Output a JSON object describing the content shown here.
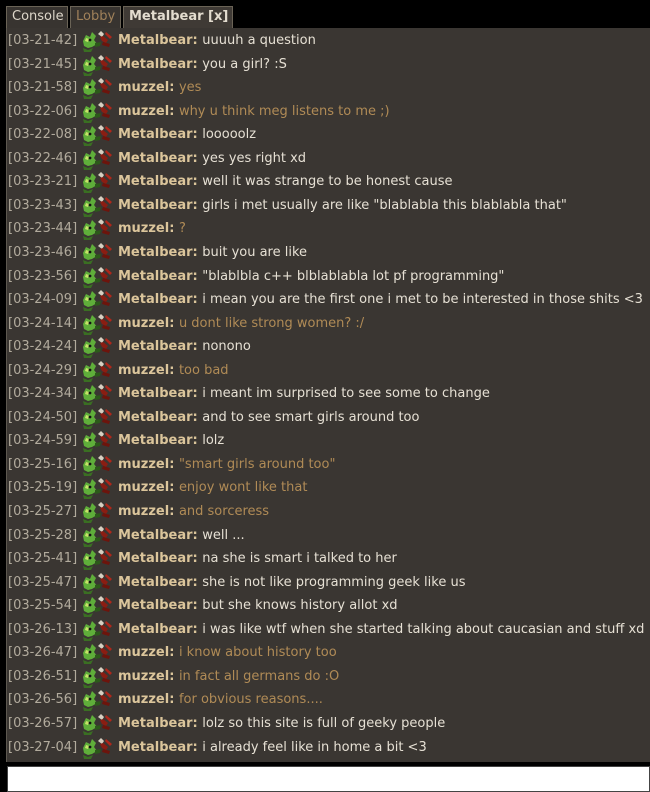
{
  "tabs": [
    {
      "label": "Console"
    },
    {
      "label": "Lobby"
    },
    {
      "label": "Metalbear [x]"
    }
  ],
  "messages": [
    {
      "time": "[03-21-42]",
      "nick": "Metalbear:",
      "text": "uuuuh a question"
    },
    {
      "time": "[03-21-45]",
      "nick": "Metalbear:",
      "text": "you a girl? :S"
    },
    {
      "time": "[03-21-58]",
      "nick": "muzzel:",
      "text": "yes"
    },
    {
      "time": "[03-22-06]",
      "nick": "muzzel:",
      "text": "why u think meg listens to me ;)"
    },
    {
      "time": "[03-22-08]",
      "nick": "Metalbear:",
      "text": "looooolz"
    },
    {
      "time": "[03-22-46]",
      "nick": "Metalbear:",
      "text": "yes yes right xd"
    },
    {
      "time": "[03-23-21]",
      "nick": "Metalbear:",
      "text": "well it was strange to be honest cause"
    },
    {
      "time": "[03-23-43]",
      "nick": "Metalbear:",
      "text": "girls i met usually are like \"blablabla this blablabla that\""
    },
    {
      "time": "[03-23-44]",
      "nick": "muzzel:",
      "text": "?"
    },
    {
      "time": "[03-23-46]",
      "nick": "Metalbear:",
      "text": "buit you are like"
    },
    {
      "time": "[03-23-56]",
      "nick": "Metalbear:",
      "text": "\"blablbla c++ blblablabla lot pf programming\""
    },
    {
      "time": "[03-24-09]",
      "nick": "Metalbear:",
      "text": "i mean you are the first one i met to be interested in those shits <3"
    },
    {
      "time": "[03-24-14]",
      "nick": "muzzel:",
      "text": "u dont like strong women? :/"
    },
    {
      "time": "[03-24-24]",
      "nick": "Metalbear:",
      "text": "nonono"
    },
    {
      "time": "[03-24-29]",
      "nick": "muzzel:",
      "text": "too bad"
    },
    {
      "time": "[03-24-34]",
      "nick": "Metalbear:",
      "text": "i meant im surprised to see some to change"
    },
    {
      "time": "[03-24-50]",
      "nick": "Metalbear:",
      "text": "and to see smart girls around too"
    },
    {
      "time": "[03-24-59]",
      "nick": "Metalbear:",
      "text": "lolz"
    },
    {
      "time": "[03-25-16]",
      "nick": "muzzel:",
      "text": "\"smart girls around too\""
    },
    {
      "time": "[03-25-19]",
      "nick": "muzzel:",
      "text": "enjoy wont like that"
    },
    {
      "time": "[03-25-27]",
      "nick": "muzzel:",
      "text": "and sorceress"
    },
    {
      "time": "[03-25-28]",
      "nick": "Metalbear:",
      "text": "well ..."
    },
    {
      "time": "[03-25-41]",
      "nick": "Metalbear:",
      "text": "na she is smart i talked to her"
    },
    {
      "time": "[03-25-47]",
      "nick": "Metalbear:",
      "text": "she is not like programming geek like us"
    },
    {
      "time": "[03-25-54]",
      "nick": "Metalbear:",
      "text": "but she knows history allot xd"
    },
    {
      "time": "[03-26-13]",
      "nick": "Metalbear:",
      "text": "i was like wtf when she started talking about caucasian and stuff xd"
    },
    {
      "time": "[03-26-47]",
      "nick": "muzzel:",
      "text": "i know about history too"
    },
    {
      "time": "[03-26-51]",
      "nick": "muzzel:",
      "text": "in fact all germans do :O"
    },
    {
      "time": "[03-26-56]",
      "nick": "muzzel:",
      "text": "for obvious reasons...."
    },
    {
      "time": "[03-26-57]",
      "nick": "Metalbear:",
      "text": "lolz so this site is full of geeky people"
    },
    {
      "time": "[03-27-04]",
      "nick": "Metalbear:",
      "text": "i already feel like in home a bit <3"
    }
  ],
  "input": {
    "value": "",
    "placeholder": ""
  },
  "icons": {
    "avatar": "orc-warrior-avatar-icon"
  },
  "colors": {
    "background": "#3a3632",
    "timestamp": "#b2ab9d",
    "nick": "#dbc59b",
    "metalbear_text": "#e6e0d4",
    "muzzel_text": "#b08b56"
  }
}
